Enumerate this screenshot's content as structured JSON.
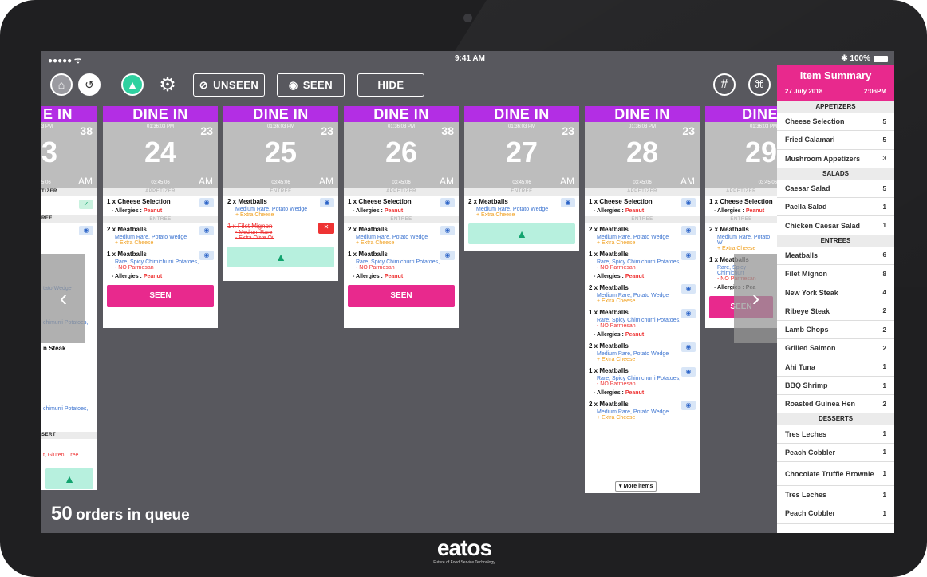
{
  "status": {
    "signal": "●●●●● ᯤ",
    "time": "9:41 AM",
    "battery": "✱ 100%"
  },
  "toolbar": {
    "unseen": "UNSEEN",
    "seen": "SEEN",
    "hide": "HIDE"
  },
  "queue": {
    "count": "50",
    "label": "orders in queue"
  },
  "cards": [
    {
      "head": "DINE IN",
      "time": "01:36:03 PM",
      "guests": "23",
      "number": "24",
      "elapsed": "03:45:06",
      "ampm": "AM"
    },
    {
      "head": "DINE IN",
      "time": "01:36:03 PM",
      "guests": "23",
      "number": "25",
      "elapsed": "03:45:06",
      "ampm": "AM"
    },
    {
      "head": "DINE IN",
      "time": "01:36:03 PM",
      "guests": "38",
      "number": "26",
      "elapsed": "03:45:06",
      "ampm": "AM"
    },
    {
      "head": "DINE IN",
      "time": "01:36:03 PM",
      "guests": "23",
      "number": "27",
      "elapsed": "03:45:06",
      "ampm": "AM"
    },
    {
      "head": "DINE IN",
      "time": "01:36:03 PM",
      "guests": "23",
      "number": "28",
      "elapsed": "03:45:06",
      "ampm": "AM"
    },
    {
      "head": "DINE I",
      "time": "01:36:03 PM",
      "guests": "",
      "number": "29",
      "elapsed": "03:45:06",
      "ampm": ""
    },
    {
      "head": "E IN",
      "time": "3 PM",
      "guests": "38",
      "number": "3",
      "elapsed": "5:06",
      "ampm": "AM"
    }
  ],
  "labels": {
    "appetizer": "APPETIZER",
    "entree": "ENTREE",
    "seen_button": "SEEN",
    "more_items": "More items",
    "cheese": "1 x Cheese Selection",
    "allergies": "- Allergies : ",
    "peanut": "Peanut",
    "meatballs2": "2 x Meatballs",
    "meatballs1": "1 x Meatballs",
    "mod_mr": "Medium Rare, Potato Wedge",
    "mod_cheese": "+ Extra Cheese",
    "mod_spicy": "Rare, Spicy Chimichurri Potatoes,",
    "mod_nopar": "- NO Parmesan",
    "filet": "1 x Filet Mignon",
    "filet_mod1": "- Medium Rare ",
    "filet_mod2": "- Extra Olive Oil",
    "left_tizer": "TIZER",
    "left_ree": "REE",
    "left_wedge": "tato Wedge",
    "left_chimi": "chimurri Potatoes,",
    "left_steak": "n Steak",
    "left_chimi2": "chimurri Potatoes,",
    "left_sert": "SERT",
    "left_gluten": "t, Gluten, Tree",
    "c29_cheese": "1 x Cheese Selection",
    "c29_mod": "Medium Rare, Potato W",
    "c29_spicy": "Rare, Spicy Chimichurr",
    "c29_nopar": "- NO Parmesan",
    "c29_allergy": "- Allergies : Pea"
  },
  "summary": {
    "title": "Item Summary",
    "date": "27 July 2018",
    "time": "2:06PM",
    "groups": [
      {
        "name": "APPETIZERS",
        "items": [
          {
            "name": "Cheese Selection",
            "count": "5"
          },
          {
            "name": "Fried Calamari",
            "count": "5"
          },
          {
            "name": "Mushroom Appetizers",
            "count": "3"
          }
        ]
      },
      {
        "name": "SALADS",
        "items": [
          {
            "name": "Caesar Salad",
            "count": "5"
          },
          {
            "name": "Paella Salad",
            "count": "1"
          },
          {
            "name": "Chicken Caesar Salad",
            "count": "1"
          }
        ]
      },
      {
        "name": "ENTREES",
        "items": [
          {
            "name": "Meatballs",
            "count": "6"
          },
          {
            "name": "Filet Mignon",
            "count": "8"
          },
          {
            "name": "New York Steak",
            "count": "4"
          },
          {
            "name": "Ribeye Steak",
            "count": "2"
          },
          {
            "name": "Lamb Chops",
            "count": "2"
          },
          {
            "name": "Grilled Salmon",
            "count": "2"
          },
          {
            "name": "Ahi Tuna",
            "count": "1"
          },
          {
            "name": "BBQ Shrimp",
            "count": "1"
          },
          {
            "name": "Roasted Guinea Hen",
            "count": "2"
          }
        ]
      },
      {
        "name": "DESSERTS",
        "items": [
          {
            "name": "Tres Leches",
            "count": "1"
          },
          {
            "name": "Peach Cobbler",
            "count": "1"
          },
          {
            "name": "Chocolate Truffle Brownie",
            "count": "1"
          },
          {
            "name": "Tres Leches",
            "count": "1"
          },
          {
            "name": "Peach Cobbler",
            "count": "1"
          }
        ]
      }
    ]
  },
  "brand": {
    "logo": "eatos",
    "tagline": "Future of Food Service Technology"
  }
}
